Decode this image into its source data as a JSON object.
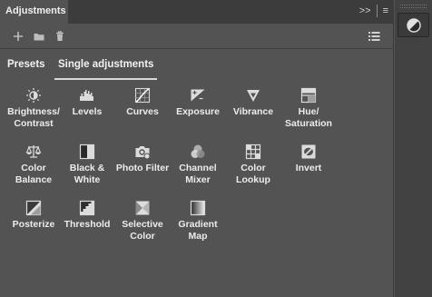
{
  "panel": {
    "title": "Adjustments",
    "collapse_glyph": ">>",
    "menu_glyph": "≡"
  },
  "toolbar": {
    "add_icon": "plus-icon",
    "folder_icon": "folder-icon",
    "delete_icon": "trash-icon",
    "list_icon": "list-icon"
  },
  "tabs": [
    {
      "label": "Presets",
      "active": false
    },
    {
      "label": "Single adjustments",
      "active": true
    }
  ],
  "adjustments": [
    {
      "line1": "Brightness/",
      "line2": "Contrast",
      "icon": "brightness-icon"
    },
    {
      "line1": "Levels",
      "line2": "",
      "icon": "levels-icon"
    },
    {
      "line1": "Curves",
      "line2": "",
      "icon": "curves-icon"
    },
    {
      "line1": "Exposure",
      "line2": "",
      "icon": "exposure-icon"
    },
    {
      "line1": "Vibrance",
      "line2": "",
      "icon": "vibrance-icon"
    },
    {
      "line1": "Hue/",
      "line2": "Saturation",
      "icon": "hue-saturation-icon"
    },
    {
      "line1": "Color",
      "line2": "Balance",
      "icon": "color-balance-icon"
    },
    {
      "line1": "Black &",
      "line2": "White",
      "icon": "black-white-icon"
    },
    {
      "line1": "Photo Filter",
      "line2": "",
      "icon": "photo-filter-icon"
    },
    {
      "line1": "Channel",
      "line2": "Mixer",
      "icon": "channel-mixer-icon"
    },
    {
      "line1": "Color",
      "line2": "Lookup",
      "icon": "color-lookup-icon"
    },
    {
      "line1": "Invert",
      "line2": "",
      "icon": "invert-icon"
    },
    {
      "line1": "Posterize",
      "line2": "",
      "icon": "posterize-icon"
    },
    {
      "line1": "Threshold",
      "line2": "",
      "icon": "threshold-icon"
    },
    {
      "line1": "Selective",
      "line2": "Color",
      "icon": "selective-color-icon"
    },
    {
      "line1": "Gradient",
      "line2": "Map",
      "icon": "gradient-map-icon"
    }
  ],
  "dock": {
    "icon": "adjustments-icon"
  }
}
